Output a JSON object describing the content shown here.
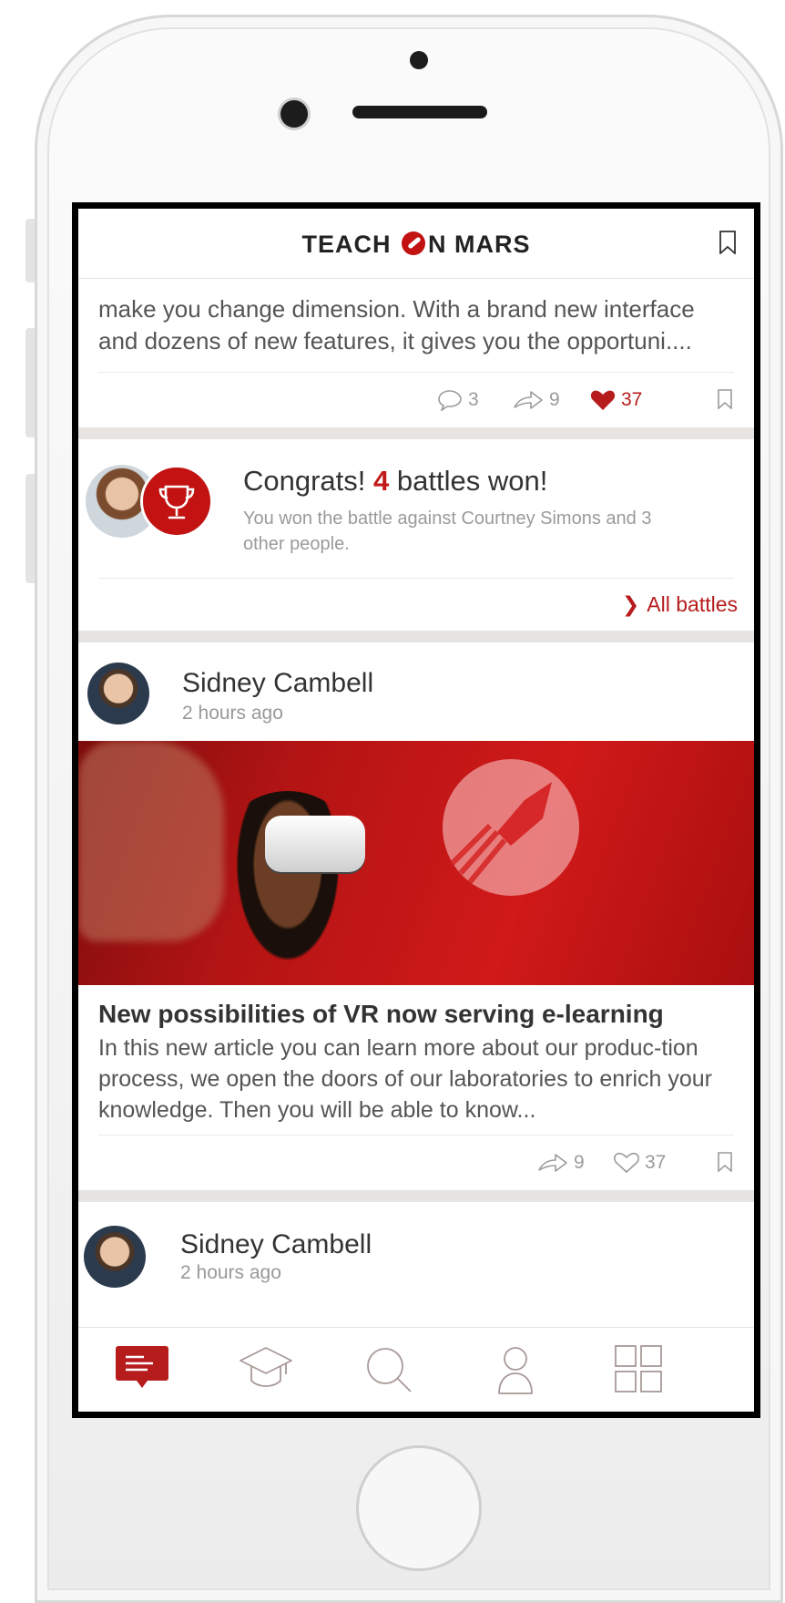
{
  "app": {
    "logo_text_left": "TEACH ",
    "logo_text_right": "N MARS"
  },
  "post_top": {
    "text": "make you change dimension. With a brand new interface and dozens of new features, it gives you the opportuni....",
    "comments": "3",
    "shares": "9",
    "likes": "37"
  },
  "battle": {
    "title_prefix": "Congrats! ",
    "count": "4",
    "title_suffix": " battles won!",
    "subtitle": "You won the battle against Courtney Simons and 3 other people.",
    "link": "All battles"
  },
  "post_article": {
    "author": "Sidney Cambell",
    "time": "2 hours ago",
    "title": "New possibilities of VR now serving e-learning",
    "text": "In this new article you can learn more about our produc-tion process, we open the doors of our laboratories to enrich your knowledge. Then you will be able to know...",
    "shares": "9",
    "likes": "37"
  },
  "post_next": {
    "author": "Sidney Cambell",
    "time": "2 hours ago"
  },
  "tabs": [
    "news-feed-icon",
    "courses-icon",
    "search-icon",
    "profile-icon",
    "apps-grid-icon"
  ],
  "colors": {
    "accent": "#c21212",
    "text": "#333333",
    "muted": "#9b9b9b",
    "separator": "#e7e4e1"
  }
}
